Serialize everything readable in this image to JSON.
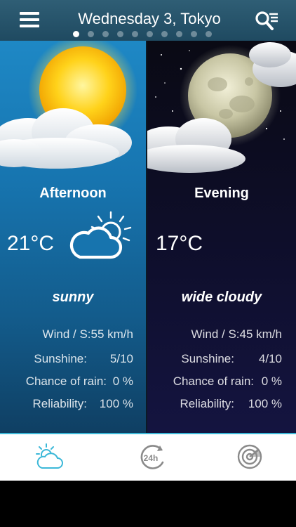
{
  "header": {
    "title": "Wednesday 3, Tokyo",
    "page_count": 10,
    "active_page": 1
  },
  "panels": [
    {
      "period": "Afternoon",
      "temp": "21°C",
      "description": "sunny",
      "art_icon": "sun-cloud-icon",
      "condition_icon": "partly-cloudy-icon",
      "details": [
        {
          "label": "Wind / S:",
          "value": "55 km/h"
        },
        {
          "label": "Sunshine:",
          "value": "5/10"
        },
        {
          "label": "Chance of rain:",
          "value": "0 %"
        },
        {
          "label": "Reliability:",
          "value": "100 %"
        }
      ]
    },
    {
      "period": "Evening",
      "temp": "17°C",
      "description": "wide cloudy",
      "art_icon": "moon-cloud-icon",
      "details": [
        {
          "label": "Wind / S:",
          "value": "45 km/h"
        },
        {
          "label": "Sunshine:",
          "value": "4/10"
        },
        {
          "label": "Chance of rain:",
          "value": "0 %"
        },
        {
          "label": "Reliability:",
          "value": "100 %"
        }
      ]
    }
  ],
  "tabs": [
    {
      "icon": "weather-icon",
      "active": true
    },
    {
      "icon": "24h-icon",
      "active": false
    },
    {
      "icon": "radar-icon",
      "active": false
    }
  ],
  "colors": {
    "header": "#2a566c",
    "accent": "#3cb8d8",
    "day_panel": "#1775b0",
    "night_panel": "#0e0e2a"
  }
}
